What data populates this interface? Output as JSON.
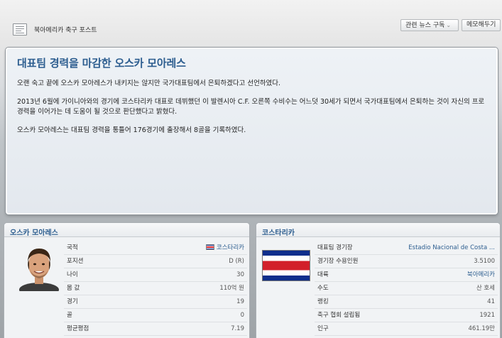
{
  "topbar": {
    "title": "북아메리카 축구 포스트",
    "related_news_button": "관련 뉴스 구독",
    "memo_button": "메모해두기"
  },
  "article": {
    "headline": "대표팀 경력을 마감한 오스카 모아레스",
    "paragraphs": [
      "오랜 숙고 끝에 오스카 모아레스가 내키지는 않지만 국가대표팀에서 은퇴하겠다고 선언하였다.",
      "2013년 6월에 가이니아와의 경기에 코스타리카 대표로 데뷔했던 이 발렌시아 C.F. 오른쪽 수비수는 어느덧 30세가 되면서 국가대표팀에서 은퇴하는 것이 자신의 프로 경력을 이어가는 데 도움이 될 것으로 판단했다고 밝혔다.",
      "오스카 모아레스는 대표팀 경력을 통틀어 176경기에 출장해서 8골을 기록하였다."
    ]
  },
  "player_panel": {
    "title": "오스카 모아레스",
    "rows": [
      {
        "label": "국적",
        "value": "코스타리카"
      },
      {
        "label": "포지션",
        "value": "D (R)"
      },
      {
        "label": "나이",
        "value": "30"
      },
      {
        "label": "몸 값",
        "value": "110억 원"
      },
      {
        "label": "경기",
        "value": "19"
      },
      {
        "label": "골",
        "value": "0"
      },
      {
        "label": "평균평점",
        "value": "7.19"
      }
    ]
  },
  "nation_panel": {
    "title": "코스타리카",
    "rows": [
      {
        "label": "대표팀 경기장",
        "value": "Estadio Nacional de Costa ..."
      },
      {
        "label": "경기장 수용인원",
        "value": "3.5100"
      },
      {
        "label": "대륙",
        "value": "북아메리카"
      },
      {
        "label": "수도",
        "value": "산 호세"
      },
      {
        "label": "랭킹",
        "value": "41"
      },
      {
        "label": "축구 협회 설립됨",
        "value": "1921"
      },
      {
        "label": "인구",
        "value": "461.19만"
      }
    ]
  },
  "colors": {
    "headline": "#2c5d8f",
    "flag_blue": "#0f2e8c",
    "flag_red": "#d21f2a"
  }
}
